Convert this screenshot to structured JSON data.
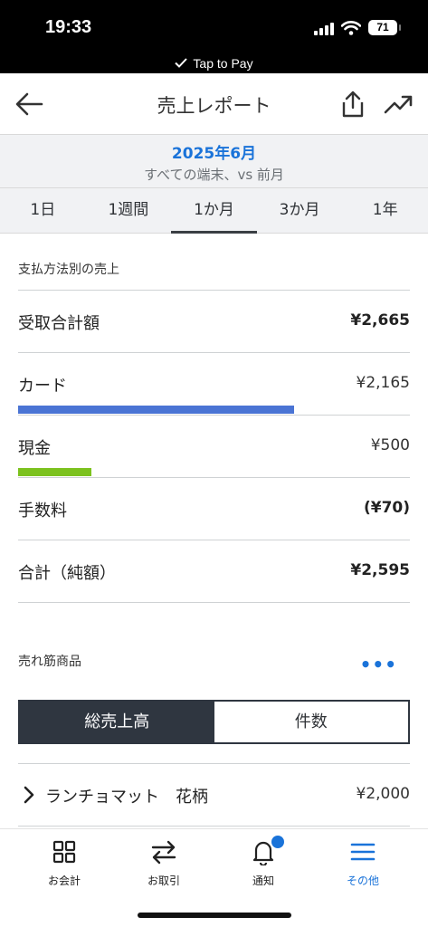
{
  "status": {
    "time": "19:33",
    "battery": "71",
    "tap_to_pay": "Tap to Pay"
  },
  "header": {
    "title": "売上レポート"
  },
  "period": {
    "month": "2025年6月",
    "subtitle": "すべての端末、vs 前月"
  },
  "tabs": [
    {
      "label": "1日"
    },
    {
      "label": "1週間"
    },
    {
      "label": "1か月"
    },
    {
      "label": "3か月"
    },
    {
      "label": "1年"
    }
  ],
  "active_tab": "1か月",
  "payment": {
    "section_title": "支払方法別の売上",
    "received_total_label": "受取合計額",
    "received_total_value": "¥2,665",
    "card_label": "カード",
    "card_value": "¥2,165",
    "card_share": 0.812,
    "card_color": "#4a74d4",
    "cash_label": "現金",
    "cash_value": "¥500",
    "cash_share": 0.188,
    "cash_color": "#7cc21e",
    "fee_label": "手数料",
    "fee_value": "(¥70)",
    "net_label": "合計（純額）",
    "net_value": "¥2,595"
  },
  "top_products": {
    "section_title": "売れ筋商品",
    "more_icon": "ellipsis-icon",
    "seg_sales": "総売上高",
    "seg_count": "件数",
    "items": [
      {
        "name": "ランチョマット　花柄",
        "value": "¥2,000"
      }
    ]
  },
  "nav": {
    "checkout": "お会計",
    "transactions": "お取引",
    "notifications": "通知",
    "more": "その他"
  },
  "colors": {
    "accent": "#1a73d9",
    "dark": "#2f3640"
  }
}
